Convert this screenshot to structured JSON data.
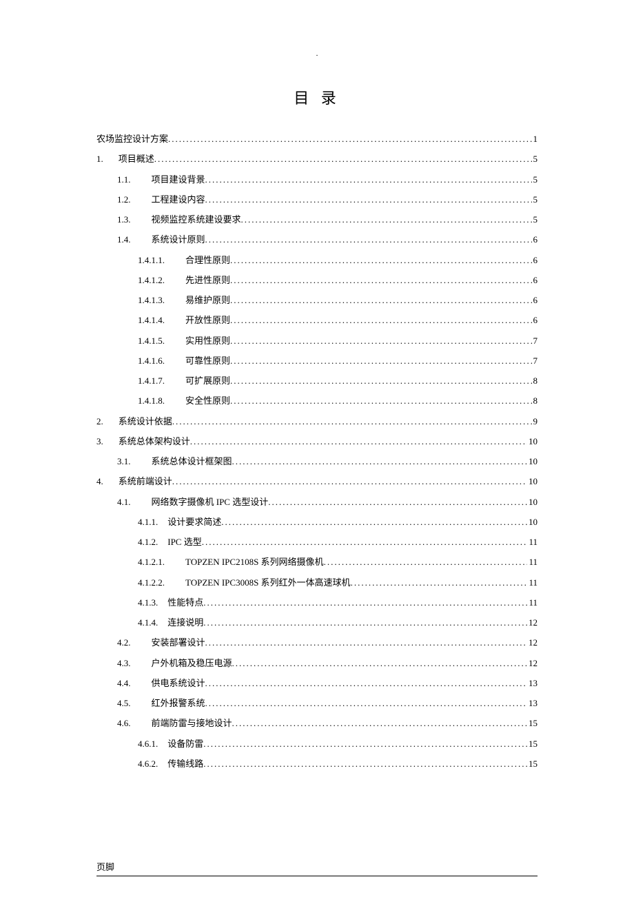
{
  "title": "目 录",
  "top_marker": ".",
  "footer": "页脚",
  "toc": [
    {
      "num": "",
      "text": "农场监控设计方案",
      "page": "1",
      "indent": 0,
      "gap": 0
    },
    {
      "num": "1.",
      "text": "项目概述",
      "page": "5",
      "indent": 1,
      "gap": 22
    },
    {
      "num": "1.1.",
      "text": "项目建设背景",
      "page": "5",
      "indent": 2,
      "gap": 30
    },
    {
      "num": "1.2.",
      "text": "工程建设内容",
      "page": "5",
      "indent": 2,
      "gap": 30
    },
    {
      "num": "1.3.",
      "text": "视频监控系统建设要求",
      "page": "5",
      "indent": 2,
      "gap": 30
    },
    {
      "num": "1.4.",
      "text": "系统设计原则",
      "page": "6",
      "indent": 2,
      "gap": 30
    },
    {
      "num": "1.4.1.1.",
      "text": "合理性原则",
      "page": "6",
      "indent": 3,
      "gap": 30
    },
    {
      "num": "1.4.1.2.",
      "text": "先进性原则",
      "page": "6",
      "indent": 3,
      "gap": 30
    },
    {
      "num": "1.4.1.3.",
      "text": "易维护原则",
      "page": "6",
      "indent": 3,
      "gap": 30
    },
    {
      "num": "1.4.1.4.",
      "text": "开放性原则",
      "page": "6",
      "indent": 3,
      "gap": 30
    },
    {
      "num": "1.4.1.5.",
      "text": "实用性原则",
      "page": "7",
      "indent": 3,
      "gap": 30
    },
    {
      "num": "1.4.1.6.",
      "text": "可靠性原则",
      "page": "7",
      "indent": 3,
      "gap": 30
    },
    {
      "num": "1.4.1.7.",
      "text": "可扩展原则",
      "page": "8",
      "indent": 3,
      "gap": 30
    },
    {
      "num": "1.4.1.8.",
      "text": "安全性原则",
      "page": "8",
      "indent": 3,
      "gap": 30
    },
    {
      "num": "2.",
      "text": "系统设计依据",
      "page": "9",
      "indent": 1,
      "gap": 22
    },
    {
      "num": "3.",
      "text": "系统总体架构设计",
      "page": "10",
      "indent": 1,
      "gap": 22
    },
    {
      "num": "3.1.",
      "text": "系统总体设计框架图",
      "page": "10",
      "indent": 2,
      "gap": 30
    },
    {
      "num": "4.",
      "text": "系统前端设计",
      "page": "10",
      "indent": 1,
      "gap": 22
    },
    {
      "num": "4.1.",
      "text": "网络数字摄像机 IPC 选型设计",
      "page": "10",
      "indent": 2,
      "gap": 30
    },
    {
      "num": "4.1.1.",
      "text": "设计要求简述",
      "page": "10",
      "indent": 3,
      "gap": 14
    },
    {
      "num": "4.1.2.",
      "text": "IPC 选型",
      "page": "11",
      "indent": 3,
      "gap": 14
    },
    {
      "num": "4.1.2.1.",
      "text": "TOPZEN IPC2108S 系列网络摄像机",
      "page": "11",
      "indent": 3,
      "gap": 30
    },
    {
      "num": "4.1.2.2.",
      "text": "TOPZEN IPC3008S 系列红外一体高速球机",
      "page": "11",
      "indent": 3,
      "gap": 30
    },
    {
      "num": "4.1.3.",
      "text": "性能特点",
      "page": "11",
      "indent": 3,
      "gap": 14
    },
    {
      "num": "4.1.4.",
      "text": "连接说明",
      "page": "12",
      "indent": 3,
      "gap": 14
    },
    {
      "num": "4.2.",
      "text": "安装部署设计",
      "page": "12",
      "indent": 2,
      "gap": 30
    },
    {
      "num": "4.3.",
      "text": "户外机箱及稳压电源",
      "page": "12",
      "indent": 2,
      "gap": 30
    },
    {
      "num": "4.4.",
      "text": "供电系统设计",
      "page": "13",
      "indent": 2,
      "gap": 30
    },
    {
      "num": "4.5.",
      "text": "红外报警系统",
      "page": "13",
      "indent": 2,
      "gap": 30
    },
    {
      "num": "4.6.",
      "text": "前端防雷与接地设计",
      "page": "15",
      "indent": 2,
      "gap": 30
    },
    {
      "num": "4.6.1.",
      "text": "设备防雷",
      "page": "15",
      "indent": 3,
      "gap": 14
    },
    {
      "num": "4.6.2.",
      "text": "传输线路",
      "page": "15",
      "indent": 3,
      "gap": 14
    }
  ]
}
